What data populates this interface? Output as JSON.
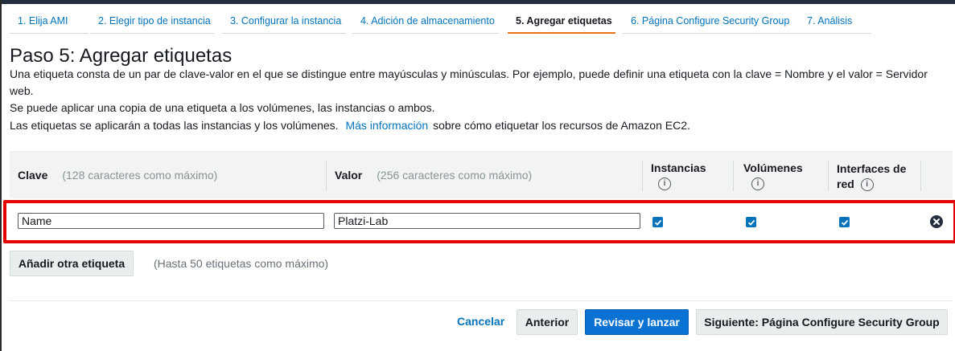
{
  "steps": [
    {
      "label": "1. Elija AMI"
    },
    {
      "label": "2. Elegir tipo de instancia"
    },
    {
      "label": "3. Configurar la instancia"
    },
    {
      "label": "4. Adición de almacenamiento"
    },
    {
      "label": "5. Agregar etiquetas"
    },
    {
      "label": "6. Página Configure Security Group"
    },
    {
      "label": "7. Análisis"
    }
  ],
  "page": {
    "title": "Paso 5: Agregar etiquetas",
    "desc1": "Una etiqueta consta de un par de clave-valor en el que se distingue entre mayúsculas y minúsculas. Por ejemplo, puede definir una etiqueta con la clave = Nombre y el valor = Servidor web.",
    "desc2": "Se puede aplicar una copia de una etiqueta a los volúmenes, las instancias o ambos.",
    "desc3_pre": "Las etiquetas se aplicarán a todas las instancias y los volúmenes.",
    "desc3_link": "Más información",
    "desc3_post": "sobre cómo etiquetar los recursos de Amazon EC2."
  },
  "table": {
    "key_header": "Clave",
    "key_hint": "(128 caracteres como máximo)",
    "value_header": "Valor",
    "value_hint": "(256 caracteres como máximo)",
    "instances_header": "Instancias",
    "volumes_header": "Volúmenes",
    "interfaces_header_1": "Interfaces de",
    "interfaces_header_2": "red",
    "info_glyph": "i",
    "rows": [
      {
        "key": "Name",
        "value": "Platzi-Lab",
        "instances": true,
        "volumes": true,
        "interfaces": true
      }
    ]
  },
  "add_tag": {
    "button": "Añadir otra etiqueta",
    "hint": "(Hasta 50 etiquetas como máximo)"
  },
  "footer": {
    "cancel": "Cancelar",
    "previous": "Anterior",
    "review": "Revisar y lanzar",
    "next": "Siguiente: Página Configure Security Group"
  },
  "colors": {
    "link": "#0073bb",
    "active_tab": "#ec7211",
    "highlight": "#e60000",
    "primary_button": "#0972d3"
  }
}
